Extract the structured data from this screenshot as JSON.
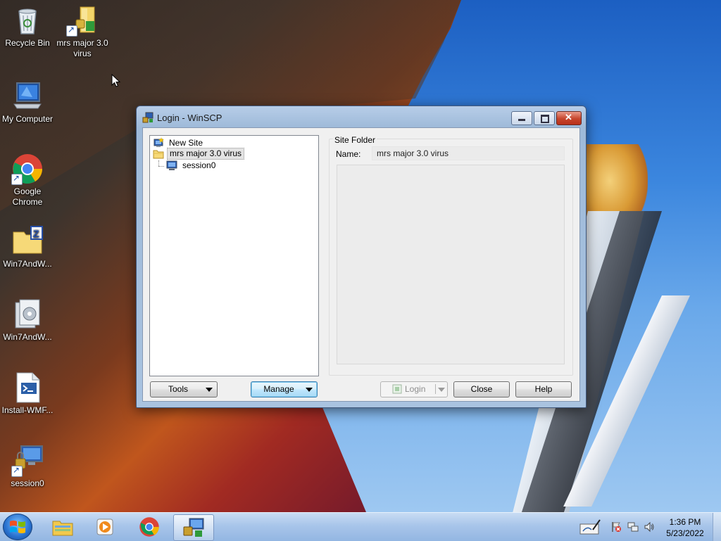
{
  "desktop": {
    "icons": [
      {
        "id": "recycle-bin",
        "label": "Recycle Bin"
      },
      {
        "id": "mrs-folder",
        "label": "mrs major 3.0 virus"
      },
      {
        "id": "my-computer",
        "label": "My Computer"
      },
      {
        "id": "google-chrome",
        "label": "Google Chrome"
      },
      {
        "id": "win7-archive",
        "label": "Win7AndW..."
      },
      {
        "id": "win7-setup",
        "label": "Win7AndW..."
      },
      {
        "id": "install-wmf",
        "label": "Install-WMF..."
      },
      {
        "id": "session0",
        "label": "session0"
      }
    ]
  },
  "window": {
    "title": "Login - WinSCP",
    "tree": [
      {
        "label": "New Site",
        "icon": "new-site-icon"
      },
      {
        "label": "mrs major 3.0 virus",
        "icon": "folder-icon",
        "selected": true
      },
      {
        "label": "session0",
        "icon": "monitor-icon"
      }
    ],
    "site_folder": {
      "group_title": "Site Folder",
      "name_label": "Name:",
      "name_value": "mrs major 3.0 virus"
    },
    "buttons": {
      "tools": "Tools",
      "manage": "Manage",
      "login": "Login",
      "close": "Close",
      "help": "Help"
    }
  },
  "taskbar": {
    "time": "1:36 PM",
    "date": "5/23/2022"
  },
  "colors": {
    "accent": "#3c7fb1",
    "taskbar": "#a8c5ea",
    "close_button": "#c6452c"
  }
}
